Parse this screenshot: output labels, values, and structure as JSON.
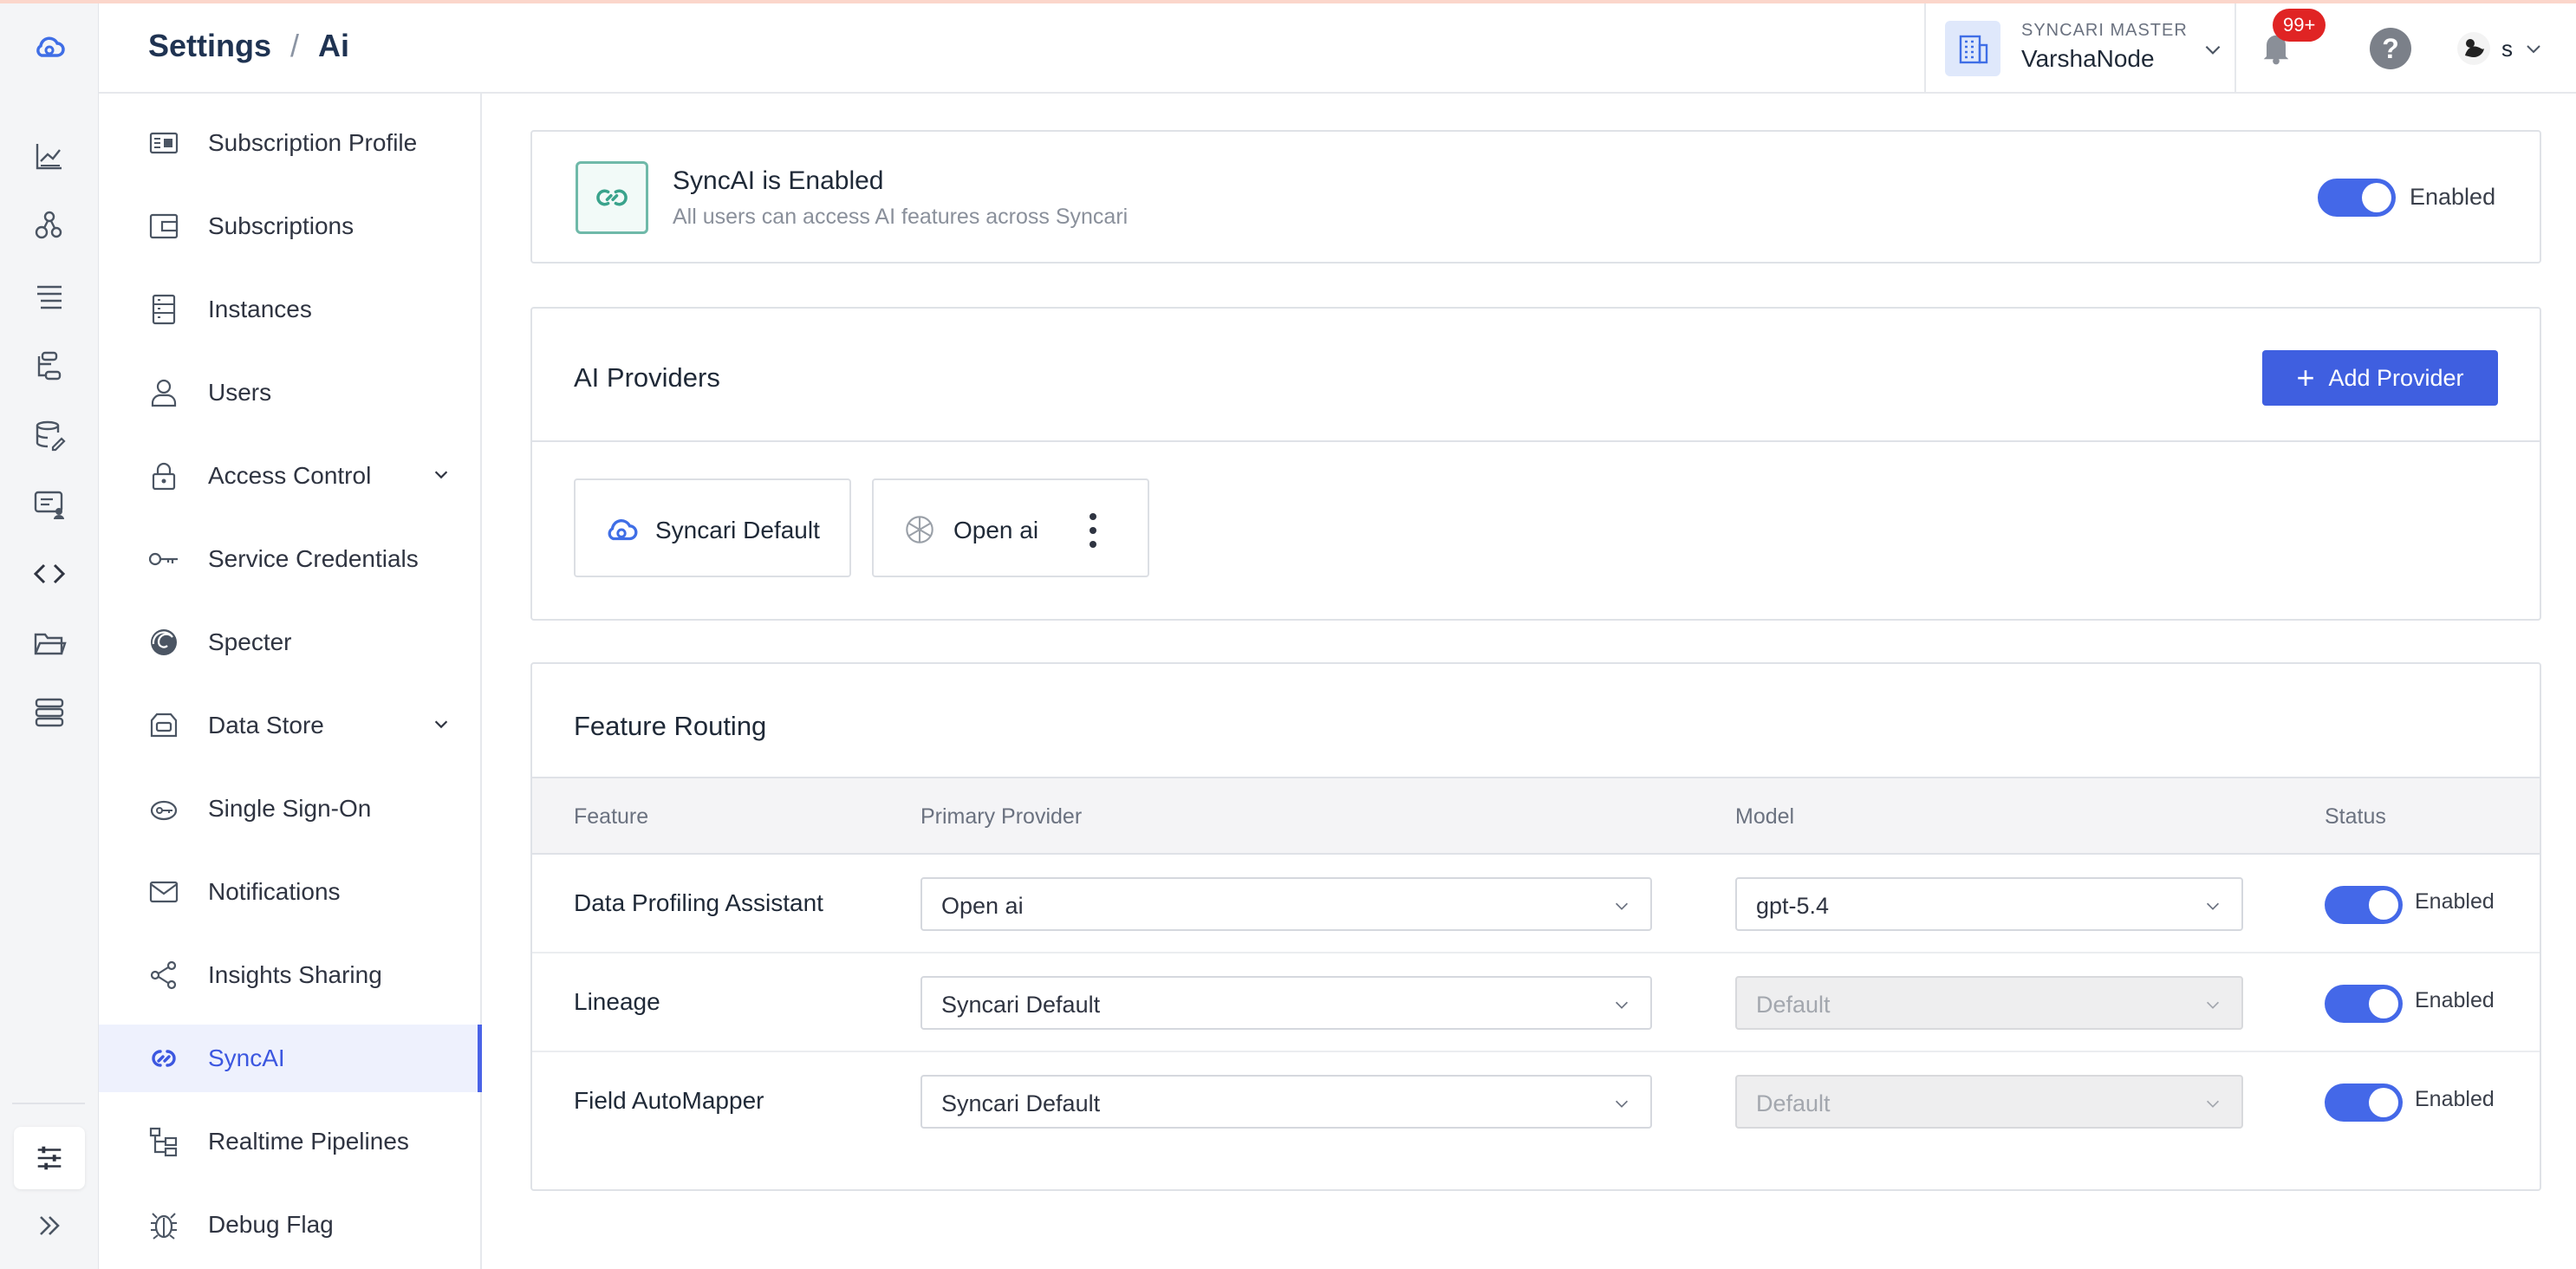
{
  "header": {
    "breadcrumb_root": "Settings",
    "breadcrumb_sep": "/",
    "breadcrumb_current": "Ai",
    "org_label": "SYNCARI MASTER",
    "org_name": "VarshaNode",
    "notification_count": "99+",
    "help_label": "?",
    "user_initial": "s"
  },
  "rail": {
    "icons": [
      "cloud-logo-icon",
      "analytics-icon",
      "graph-icon",
      "list-icon",
      "pipeline-icon",
      "database-edit-icon",
      "monitor-user-icon",
      "code-icon",
      "folder-icon",
      "stack-icon",
      "settings-sliders-icon",
      "expand-icon"
    ]
  },
  "sidebar": {
    "items": [
      {
        "label": "Subscription Profile",
        "icon": "profile-card-icon"
      },
      {
        "label": "Subscriptions",
        "icon": "wallet-icon"
      },
      {
        "label": "Instances",
        "icon": "server-icon"
      },
      {
        "label": "Users",
        "icon": "user-icon"
      },
      {
        "label": "Access Control",
        "icon": "lock-icon"
      },
      {
        "label": "Service Credentials",
        "icon": "key-icon"
      },
      {
        "label": "Specter",
        "icon": "specter-icon"
      },
      {
        "label": "Data Store",
        "icon": "storage-icon"
      },
      {
        "label": "Single Sign-On",
        "icon": "sso-key-icon"
      },
      {
        "label": "Notifications",
        "icon": "mail-icon"
      },
      {
        "label": "Insights Sharing",
        "icon": "share-icon"
      },
      {
        "label": "SyncAI",
        "icon": "syncai-icon"
      },
      {
        "label": "Realtime Pipelines",
        "icon": "tree-icon"
      },
      {
        "label": "Debug Flag",
        "icon": "bug-icon"
      }
    ]
  },
  "banner": {
    "title": "SyncAI is Enabled",
    "subtitle": "All users can access AI features across Syncari",
    "toggle_label": "Enabled"
  },
  "providers": {
    "title": "AI Providers",
    "add_button": "Add Provider",
    "list": [
      {
        "name": "Syncari Default",
        "icon": "syncari-cloud-icon"
      },
      {
        "name": "Open ai",
        "icon": "openai-icon"
      }
    ]
  },
  "routing": {
    "title": "Feature Routing",
    "columns": [
      "Feature",
      "Primary Provider",
      "Model",
      "Status"
    ],
    "rows": [
      {
        "feature": "Data Profiling Assistant",
        "provider": "Open ai",
        "model": "gpt-5.4",
        "model_disabled": false,
        "status": "Enabled"
      },
      {
        "feature": "Lineage",
        "provider": "Syncari Default",
        "model": "Default",
        "model_disabled": true,
        "status": "Enabled"
      },
      {
        "feature": "Field AutoMapper",
        "provider": "Syncari Default",
        "model": "Default",
        "model_disabled": true,
        "status": "Enabled"
      }
    ]
  },
  "colors": {
    "accent": "#4468e8",
    "button": "#3f5fe0",
    "badge": "#e02424",
    "active_bg": "#eef1fd"
  }
}
